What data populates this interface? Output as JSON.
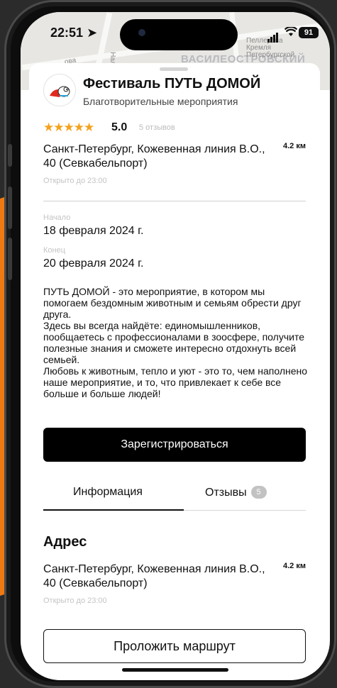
{
  "status_bar": {
    "time": "22:51",
    "battery": "91"
  },
  "map": {
    "district_label": "ВАСИЛЕОСТРОВСКИЙ",
    "street_label_1": "Нал",
    "street_label_2": "ова",
    "poi_label": "Пеллерова Кремля Петербургской"
  },
  "event": {
    "title": "Фестиваль ПУТЬ ДОМОЙ",
    "category": "Благотворительные мероприятия",
    "stars": "★★★★★",
    "rating": "5.0",
    "reviews_count": "5 отзывов",
    "address": "Санкт-Петербург, Кожевенная линия В.О., 40 (Севкабельпорт)",
    "distance": "4.2 км",
    "hours": "Открыто до 23:00",
    "start_label": "Начало",
    "start_date": "18 февраля 2024 г.",
    "end_label": "Конец",
    "end_date": "20 февраля 2024 г.",
    "description": "ПУТЬ ДОМОЙ - это мероприятие, в котором мы помогаем бездомным животным и семьям обрести друг друга.\nЗдесь вы всегда найдёте: единомышленников, пообщаетесь с профессионалами в зоосфере, получите полезные знания и сможете интересно отдохнуть всей семьей.\nЛюбовь к животным, тепло и уют - это то, чем наполнено наше мероприятие, и то, что привлекает к себе все больше и больше людей!"
  },
  "actions": {
    "register_label": "Зарегистрироваться",
    "route_label": "Проложить маршрут"
  },
  "tabs": [
    {
      "label": "Информация",
      "active": true
    },
    {
      "label": "Отзывы",
      "badge": "5",
      "active": false
    }
  ],
  "address_section": {
    "title": "Адрес",
    "address": "Санкт-Петербург, Кожевенная линия В.О., 40 (Севкабельпорт)",
    "distance": "4.2 км",
    "hours": "Открыто до 23:00"
  },
  "colors": {
    "accent_orange": "#f07a12",
    "star_color": "#f4a21d",
    "primary_button": "#000000"
  }
}
